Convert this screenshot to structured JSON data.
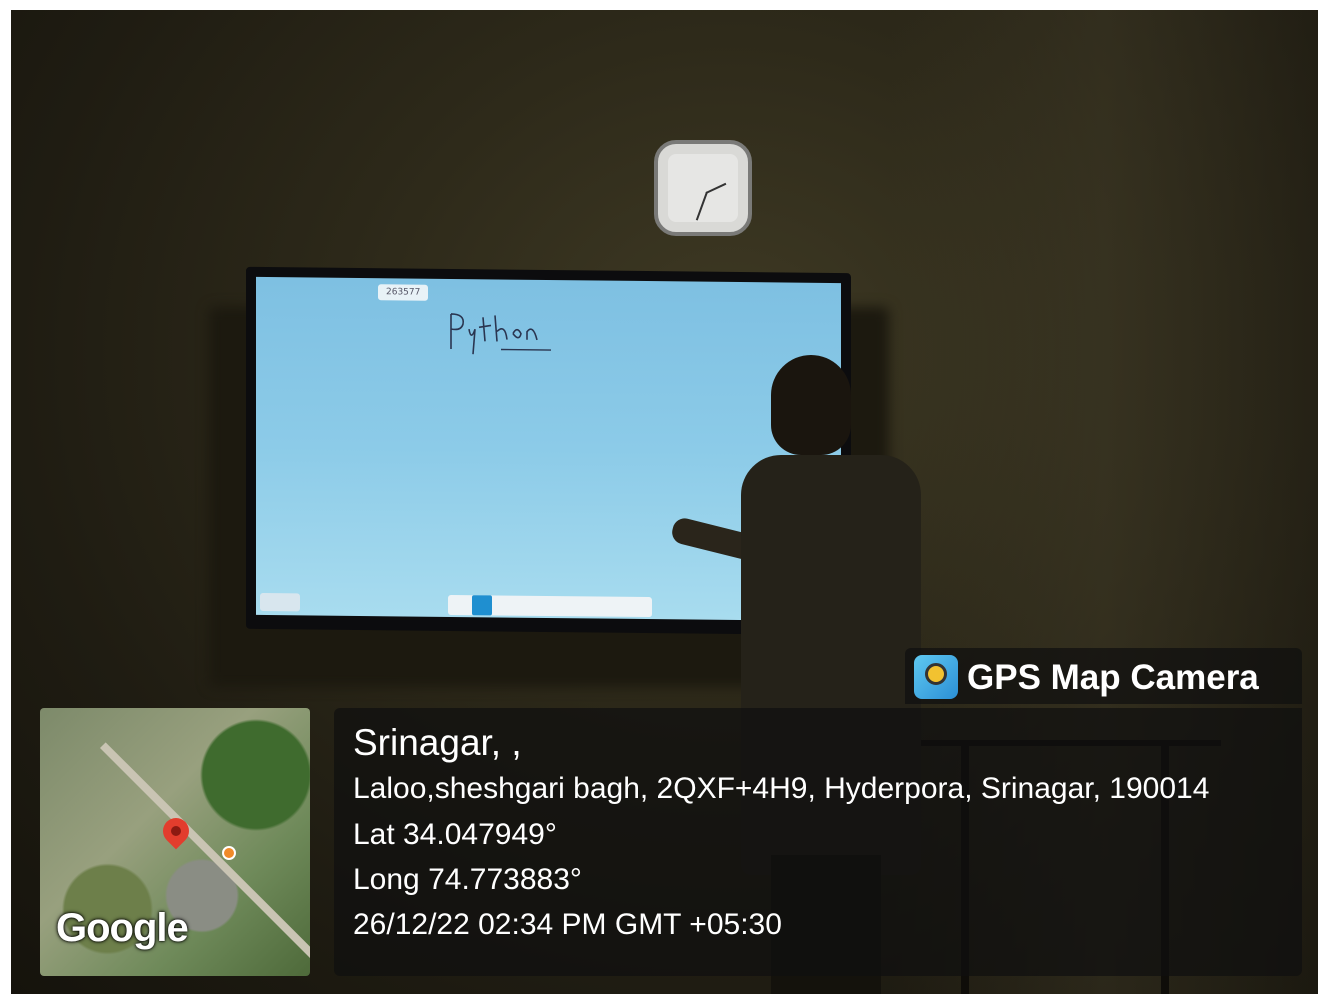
{
  "scene": {
    "whiteboard_id": "263577",
    "whiteboard_text": "Python"
  },
  "gps_overlay": {
    "app_name": "GPS Map Camera",
    "map_logo": "Google",
    "city": "Srinagar, ,",
    "address": "Laloo,sheshgari bagh, 2QXF+4H9, Hyderpora, Srinagar, 190014",
    "latitude": "Lat 34.047949°",
    "longitude": "Long 74.773883°",
    "datetime": "26/12/22 02:34 PM GMT +05:30",
    "icons": [
      "gps-map-camera-app-icon",
      "map-pin-icon"
    ]
  }
}
